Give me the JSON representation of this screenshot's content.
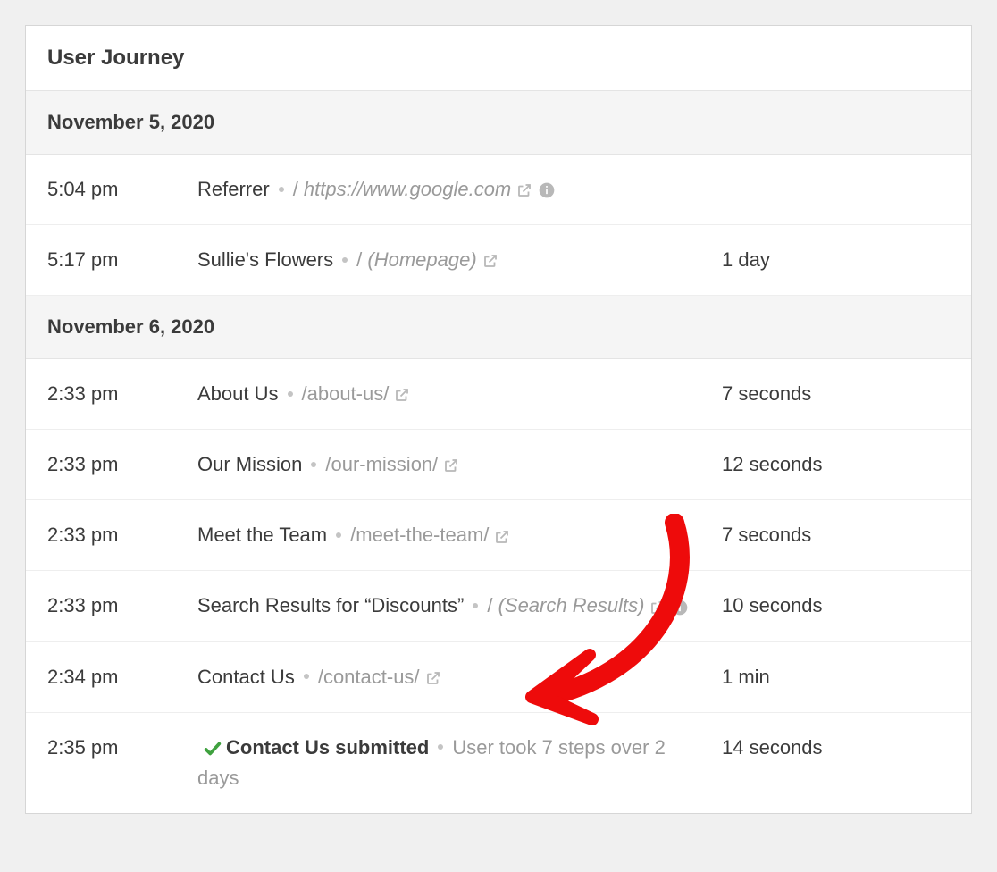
{
  "panel": {
    "title": "User Journey"
  },
  "groups": [
    {
      "date": "November 5, 2020",
      "rows": [
        {
          "time": "5:04 pm",
          "title": "Referrer",
          "pathPrefix": "/ ",
          "path": "https://www.google.com",
          "pathItalic": true,
          "extlink": true,
          "info": true,
          "duration": ""
        },
        {
          "time": "5:17 pm",
          "title": "Sullie's Flowers",
          "pathPrefix": "/ ",
          "path": "(Homepage)",
          "pathItalic": true,
          "extlink": true,
          "info": false,
          "duration": "1 day"
        }
      ]
    },
    {
      "date": "November 6, 2020",
      "rows": [
        {
          "time": "2:33 pm",
          "title": "About Us",
          "pathPrefix": "",
          "path": "/about-us/",
          "pathItalic": false,
          "extlink": true,
          "info": false,
          "duration": "7 seconds"
        },
        {
          "time": "2:33 pm",
          "title": "Our Mission",
          "pathPrefix": "",
          "path": "/our-mission/",
          "pathItalic": false,
          "extlink": true,
          "info": false,
          "duration": "12 seconds"
        },
        {
          "time": "2:33 pm",
          "title": "Meet the Team",
          "pathPrefix": "",
          "path": "/meet-the-team/",
          "pathItalic": false,
          "extlink": true,
          "info": false,
          "duration": "7 seconds"
        },
        {
          "time": "2:33 pm",
          "title": "Search Results for “Discounts”",
          "pathPrefix": "/ ",
          "path": "(Search Results)",
          "pathItalic": true,
          "extlink": true,
          "info": true,
          "duration": "10 seconds"
        },
        {
          "time": "2:34 pm",
          "title": "Contact Us",
          "pathPrefix": "",
          "path": "/contact-us/",
          "pathItalic": false,
          "extlink": true,
          "info": false,
          "duration": "1 min"
        },
        {
          "time": "2:35 pm",
          "submitted": true,
          "submittedTitle": "Contact Us submitted",
          "summary": "User took 7 steps over 2 days",
          "duration": "14 seconds"
        }
      ]
    }
  ],
  "colors": {
    "check": "#3fa13f",
    "arrow": "#ee0b0b",
    "muted": "#9a9a9a"
  }
}
